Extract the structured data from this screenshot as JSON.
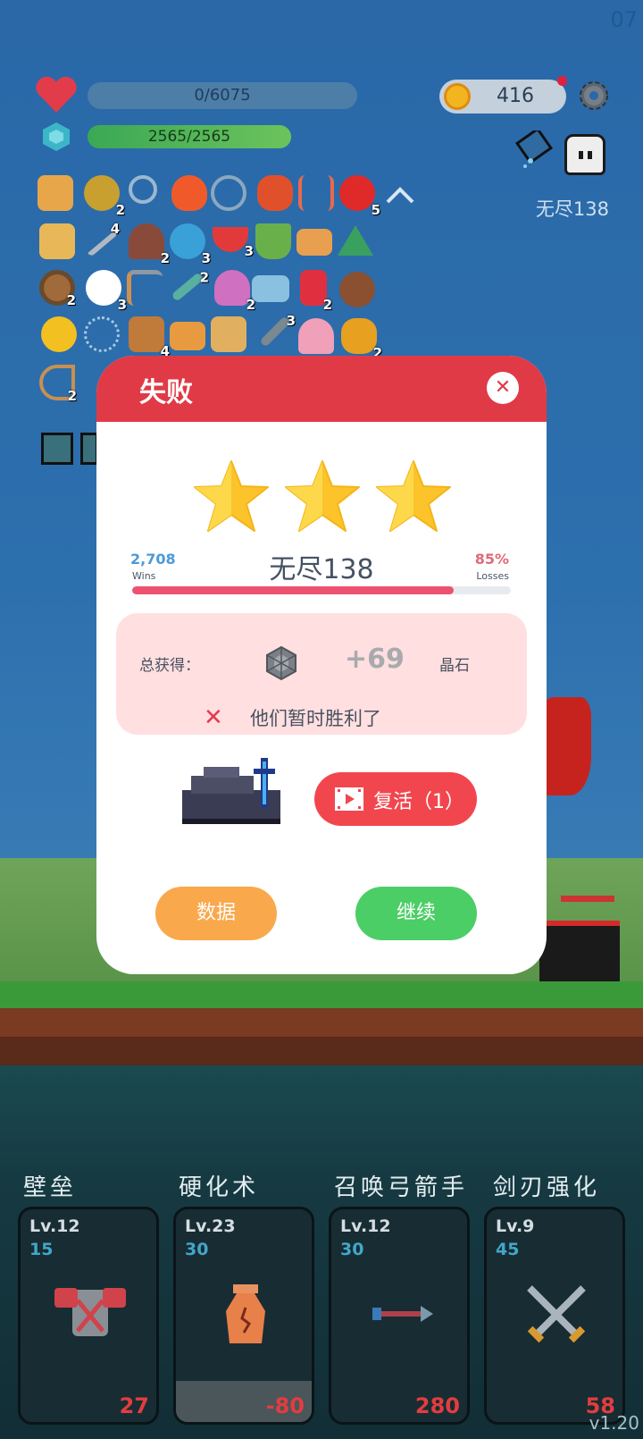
{
  "hud": {
    "corner_number": "07",
    "hp_text": "0/6075",
    "mp_text": "2565/2565",
    "coins": "416",
    "mode_label": "无尽138"
  },
  "item_counts": {
    "egg": "2",
    "apple": "5",
    "sword": "4",
    "door": "2",
    "chat": "3",
    "melon": "3",
    "shield": "2",
    "flower": "3",
    "pen": "2",
    "pot": "2",
    "bookmark": "2",
    "book": "4",
    "knife": "3",
    "pineapple": "2",
    "bow": "2"
  },
  "dialog": {
    "title": "失败",
    "close": "✕",
    "stars": 3,
    "level_title": "无尽138",
    "wins_value": "2,708",
    "wins_label": "Wins",
    "losses_value": "85%",
    "losses_label": "Losses",
    "loss_fraction": 0.85,
    "reward_label": "总获得：",
    "reward_amount": "+69",
    "reward_unit": "晶石",
    "fail_message": "他们暂时胜利了",
    "revive_label": "复活（1）",
    "stats_label": "数据",
    "continue_label": "继续"
  },
  "skills": [
    {
      "name": "壁垒",
      "level": "Lv.12",
      "cost": "15",
      "value": "27"
    },
    {
      "name": "硬化术",
      "level": "Lv.23",
      "cost": "30",
      "value": "-80"
    },
    {
      "name": "召唤弓箭手",
      "level": "Lv.12",
      "cost": "30",
      "value": "280"
    },
    {
      "name": "剑刃强化",
      "level": "Lv.9",
      "cost": "45",
      "value": "58"
    }
  ],
  "version": "v1.20",
  "colors": {
    "header_red": "#e03a47",
    "revive_red": "#f2464f",
    "stats_orange": "#f9a84c",
    "continue_green": "#4cce66",
    "wins_blue": "#4c9ad8",
    "losses_pink": "#e06a78"
  }
}
